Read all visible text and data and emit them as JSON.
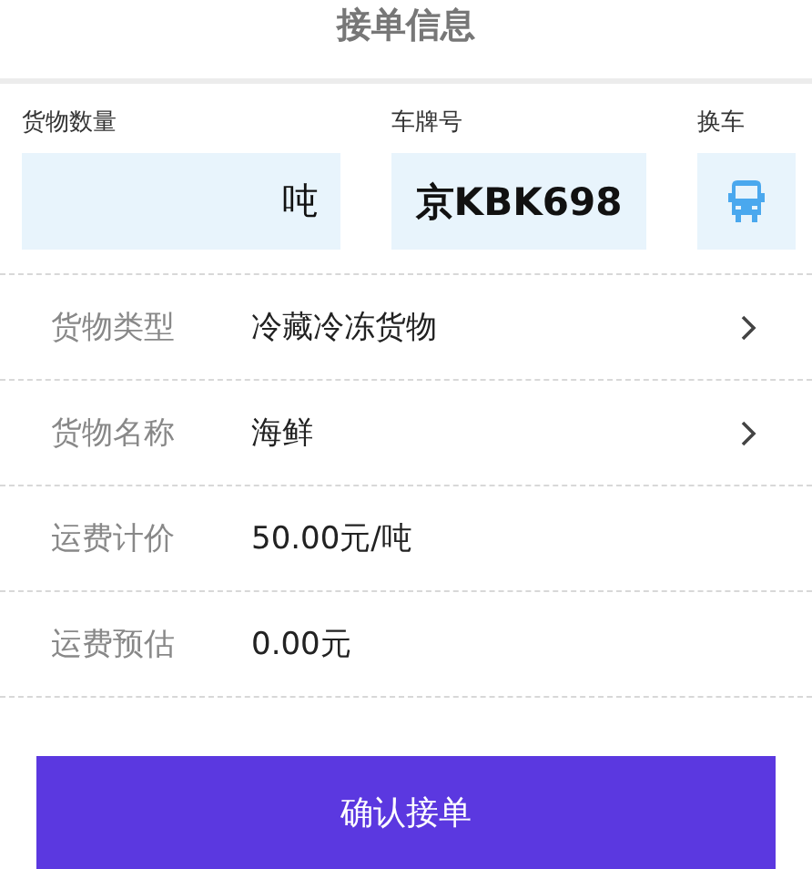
{
  "title": "接单信息",
  "quantity": {
    "label": "货物数量",
    "unit": "吨"
  },
  "plate": {
    "label": "车牌号",
    "value": "京KBK698"
  },
  "switch_vehicle": {
    "label": "换车"
  },
  "rows": [
    {
      "kind": "select",
      "label": "货物类型",
      "value": "冷藏冷冻货物"
    },
    {
      "kind": "select",
      "label": "货物名称",
      "value": "海鲜"
    },
    {
      "kind": "text",
      "label": "运费计价",
      "value": "50.00元/吨"
    },
    {
      "kind": "text",
      "label": "运费预估",
      "value": "0.00元"
    }
  ],
  "confirm_button": "确认接单"
}
